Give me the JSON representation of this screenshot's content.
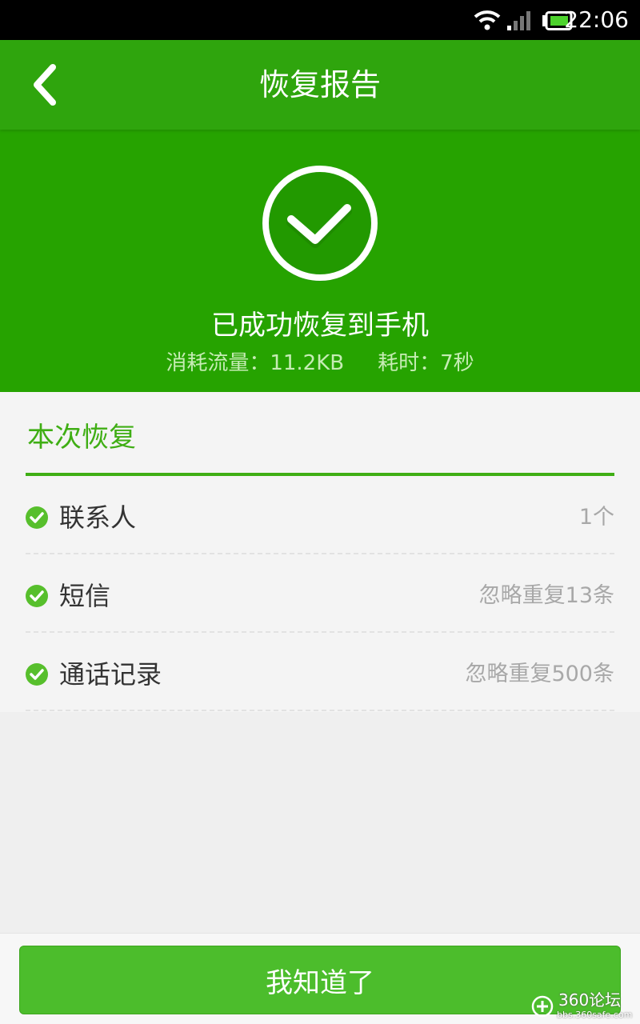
{
  "status_bar": {
    "time": "22:06",
    "icons": [
      "wifi-icon",
      "signal-icon",
      "battery-icon"
    ]
  },
  "header": {
    "title": "恢复报告",
    "back_icon": "chevron-left-icon"
  },
  "result": {
    "icon": "check-circle-icon",
    "headline": "已成功恢复到手机",
    "data_usage": "消耗流量：11.2KB",
    "duration": "耗时：7秒"
  },
  "section": {
    "title": "本次恢复",
    "items": [
      {
        "label": "联系人",
        "value": "1个",
        "icon": "check-badge-icon"
      },
      {
        "label": "短信",
        "value": "忽略重复13条",
        "icon": "check-badge-icon"
      },
      {
        "label": "通话记录",
        "value": "忽略重复500条",
        "icon": "check-badge-icon"
      }
    ]
  },
  "footer": {
    "confirm_label": "我知道了"
  },
  "watermark": {
    "title": "360论坛",
    "url": "bbs.360safe.com"
  },
  "colors": {
    "title_bar": "#2fa50d",
    "hero": "#26a300",
    "accent": "#3fae14",
    "button": "#4cbd2c"
  }
}
